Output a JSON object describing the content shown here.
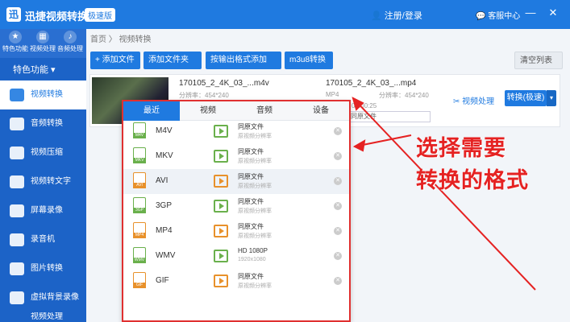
{
  "titlebar": {
    "title": "迅捷视频转换器",
    "badge": "极速版",
    "login": "注册/登录",
    "service": "客服中心",
    "minimize": "—",
    "close": "✕"
  },
  "topnav": {
    "items": [
      {
        "label": "特色功能"
      },
      {
        "label": "视频处理"
      },
      {
        "label": "音频处理"
      }
    ]
  },
  "sidebar": {
    "heading": "特色功能 ▾",
    "items": [
      {
        "label": "视频转换"
      },
      {
        "label": "音频转换"
      },
      {
        "label": "视频压缩"
      },
      {
        "label": "视频转文字"
      },
      {
        "label": "屏幕录像"
      },
      {
        "label": "录音机"
      },
      {
        "label": "图片转换"
      },
      {
        "label": "虚拟背景录像"
      },
      {
        "label": "视频处理"
      }
    ]
  },
  "breadcrumb": "首页 〉 视频转换",
  "toolbar": {
    "add_file": "+ 添加文件",
    "add_folder": "添加文件夹",
    "batch_add": "按输出格式添加",
    "m3u8": "m3u8转换",
    "clear": "清空列表"
  },
  "file": {
    "src_name": "170105_2_4K_03_...m4v",
    "src_info": "分辨率：454*240",
    "dst_name": "170105_2_4K_03_...mp4",
    "dst_fmt": "MP4",
    "dst_res": "分辨率：454*240",
    "dst_duration": "00:00:25",
    "dst_quality": "同原文件",
    "video_process": "视频处理",
    "convert": "转换(极速)",
    "convert_dd": "▾"
  },
  "format_panel": {
    "tabs": [
      "最近",
      "视频",
      "音频",
      "设备"
    ],
    "rows": [
      {
        "format": "M4V",
        "preset": "同原文件",
        "sub": "原视频分辨率",
        "color": "green"
      },
      {
        "format": "MKV",
        "preset": "同原文件",
        "sub": "原视频分辨率",
        "color": "green"
      },
      {
        "format": "AVI",
        "preset": "同原文件",
        "sub": "原视频分辨率",
        "color": "orange"
      },
      {
        "format": "3GP",
        "preset": "同原文件",
        "sub": "原视频分辨率",
        "color": "green"
      },
      {
        "format": "MP4",
        "preset": "同原文件",
        "sub": "原视频分辨率",
        "color": "orange"
      },
      {
        "format": "WMV",
        "preset": "HD 1080P",
        "sub": "1920x1080",
        "color": "green"
      },
      {
        "format": "GIF",
        "preset": "同原文件",
        "sub": "原视频分辨率",
        "color": "orange"
      }
    ]
  },
  "annotation": {
    "line1": "选择需要",
    "line2": "转换的格式",
    "color": "#e52222"
  }
}
